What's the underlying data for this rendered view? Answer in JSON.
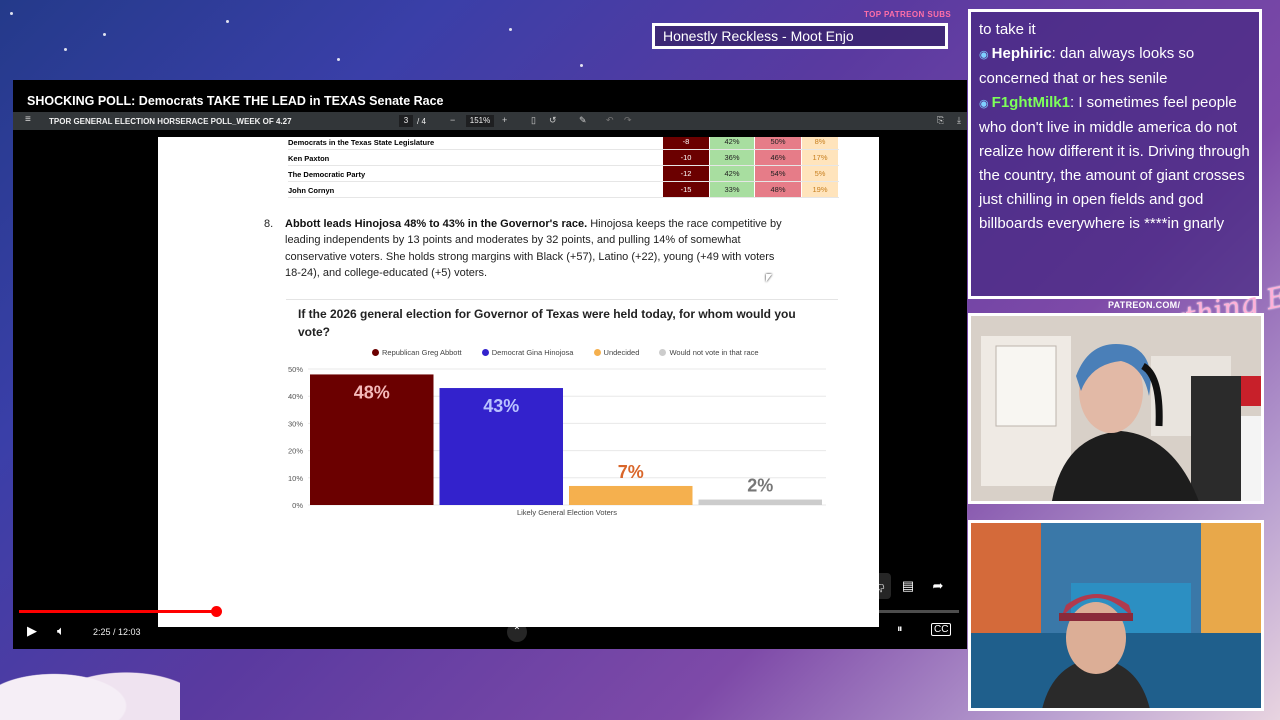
{
  "stream": {
    "top_subs_label": "TOP PATREON SUBS",
    "ticker": "Honestly Reckless - Moot Enjo",
    "patreon": "PATREON.COM/",
    "logo": "Anything Else?"
  },
  "player": {
    "title": "SHOCKING POLL: Democrats TAKE THE LEAD in TEXAS Senate Race",
    "time_text": "2:25 / 12:03",
    "progress": 0.21,
    "buffered": 0.25
  },
  "pdf": {
    "doc_name": "TPOR GENERAL ELECTION HORSERACE POLL_WEEK OF 4.27",
    "page_current": "3",
    "page_sep": "/",
    "page_total": "4",
    "zoom": "151%"
  },
  "fav_table": [
    {
      "name": "Democrats in the Texas State Legislature",
      "net": "-8",
      "fav": "42%",
      "unfav": "50%",
      "unsure": "8%"
    },
    {
      "name": "Ken Paxton",
      "net": "-10",
      "fav": "36%",
      "unfav": "46%",
      "unsure": "17%"
    },
    {
      "name": "The Democratic Party",
      "net": "-12",
      "fav": "42%",
      "unfav": "54%",
      "unsure": "5%"
    },
    {
      "name": "John Cornyn",
      "net": "-15",
      "fav": "33%",
      "unfav": "48%",
      "unsure": "19%"
    }
  ],
  "finding": {
    "number": "8.",
    "bold": "Abbott leads Hinojosa 48% to 43% in the Governor's race.",
    "text": " Hinojosa keeps the race competitive by leading independents by 13 points and moderates by 32 points, and pulling 14% of somewhat conservative voters. She holds strong margins with Black (+57), Latino (+22), young (+49 with voters 18-24), and college-educated (+5) voters."
  },
  "chart_data": {
    "type": "bar",
    "title": "If the 2026 general election for Governor of Texas were held today, for whom would you vote?",
    "xlabel": "Likely General Election Voters",
    "ylabel": "",
    "ylim": [
      0,
      50
    ],
    "yticks": [
      "0%",
      "10%",
      "20%",
      "30%",
      "40%",
      "50%"
    ],
    "grid": true,
    "legend_position": "top",
    "series": [
      {
        "name": "Republican Greg Abbott",
        "value": 48,
        "label": "48%",
        "color": "#6b0000",
        "label_color": "#f4b9b9"
      },
      {
        "name": "Democrat Gina Hinojosa",
        "value": 43,
        "label": "43%",
        "color": "#3322cc",
        "label_color": "#b9c2ff"
      },
      {
        "name": "Undecided",
        "value": 7,
        "label": "7%",
        "color": "#f5b04e",
        "label_color": "#d9662a"
      },
      {
        "name": "Would not vote in that race",
        "value": 2,
        "label": "2%",
        "color": "#cccccc",
        "label_color": "#777777"
      }
    ]
  },
  "chat": [
    {
      "user": "",
      "text": "to take it",
      "user_color": "#ffffff"
    },
    {
      "user": "Hephiric",
      "text": ": dan always looks so concerned that or hes senile",
      "user_color": "#ffffff"
    },
    {
      "user": "F1ghtMilk1",
      "text": ": I sometimes feel people who don't live in middle america do not realize how different it is. Driving through the country, the amount of giant crosses just chilling in open fields and god billboards everywhere is ****in gnarly",
      "user_color": "#7dff5a"
    }
  ]
}
